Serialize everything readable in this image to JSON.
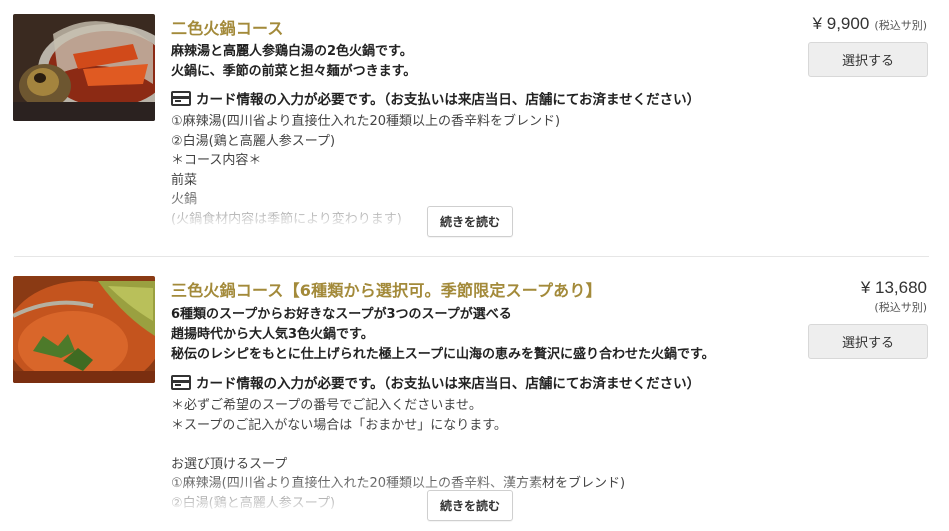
{
  "courses": [
    {
      "title": "二色火鍋コース",
      "description": [
        "麻辣湯と高麗人参鶏白湯の2色火鍋です。",
        "火鍋に、季節の前菜と担々麺がつきます。"
      ],
      "card_notice": "カード情報の入力が必要です。（お支払いは来店当日、店舗にてお済ませください）",
      "details": [
        "①麻辣湯(四川省より直接仕入れた20種類以上の香辛料をブレンド)",
        "②白湯(鶏と高麗人参スープ)",
        "＊コース内容＊",
        "前菜",
        "火鍋",
        "(火鍋食材内容は季節により変わります)"
      ],
      "read_more_label": "続きを読む",
      "price": "¥ 9,900",
      "tax_note": "(税込サ別)",
      "select_label": "選択する",
      "image": "hot-pot-photo"
    },
    {
      "title": "三色火鍋コース【6種類から選択可。季節限定スープあり】",
      "description": [
        "6種類のスープからお好きなスープが3つのスープが選べる",
        "趙揚時代から大人気3色火鍋です。",
        "秘伝のレシピをもとに仕上げられた極上スープに山海の恵みを贅沢に盛り合わせた火鍋です。"
      ],
      "card_notice": "カード情報の入力が必要です。（お支払いは来店当日、店舗にてお済ませください）",
      "details": [
        "＊必ずご希望のスープの番号でご記入くださいませ。",
        "＊スープのご記入がない場合は「おまかせ」になります。",
        "",
        "お選び頂けるスープ",
        "①麻辣湯(四川省より直接仕入れた20種類以上の香辛料、漢方素材をブレンド)",
        "②白湯(鶏と高麗人参スープ)"
      ],
      "read_more_label": "続きを読む",
      "price": "¥ 13,680",
      "tax_note": "(税込サ別)",
      "select_label": "選択する",
      "image": "hot-pot-photo"
    }
  ],
  "colors": {
    "title": "#a38a3a",
    "button_bg": "#eeeeee"
  },
  "icons": {
    "card": "credit-card-icon"
  }
}
